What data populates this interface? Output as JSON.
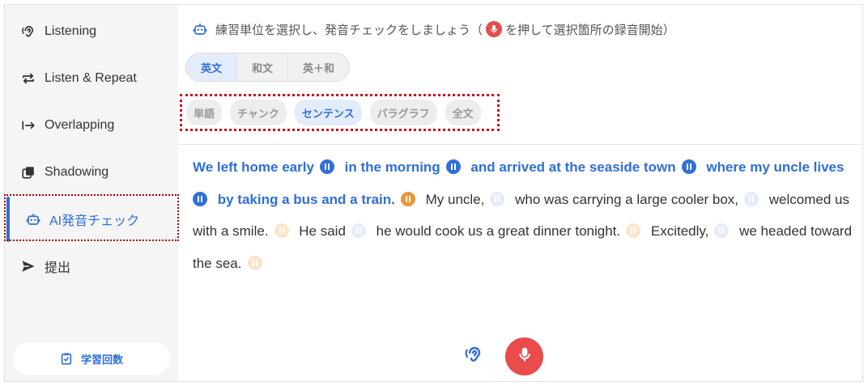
{
  "sidebar": {
    "items": [
      {
        "label": "Listening",
        "icon": "ear-icon"
      },
      {
        "label": "Listen & Repeat",
        "icon": "repeat-icon"
      },
      {
        "label": "Overlapping",
        "icon": "arrow-to-bar-icon"
      },
      {
        "label": "Shadowing",
        "icon": "shadow-squares-icon"
      },
      {
        "label": "AI発音チェック",
        "icon": "robot-icon",
        "active": true
      },
      {
        "label": "提出",
        "icon": "send-icon"
      }
    ],
    "study_count_label": "学習回数"
  },
  "main": {
    "instruction_before": "練習単位を選択し、発音チェックをしましょう（",
    "instruction_after": "を押して選択箇所の録音開始）",
    "lang_tabs": [
      {
        "label": "英文",
        "active": true
      },
      {
        "label": "和文",
        "active": false
      },
      {
        "label": "英＋和",
        "active": false
      }
    ],
    "unit_tabs": [
      {
        "label": "単語",
        "active": false
      },
      {
        "label": "チャンク",
        "active": false
      },
      {
        "label": "センテンス",
        "active": true
      },
      {
        "label": "パラグラフ",
        "active": false
      },
      {
        "label": "全文",
        "active": false
      }
    ],
    "passage": [
      {
        "text": "We left home early",
        "highlight": true,
        "button": "blue"
      },
      {
        "text": "in the morning",
        "highlight": true,
        "button": "blue"
      },
      {
        "text": "and arrived at the seaside town",
        "highlight": true,
        "button": "blue"
      },
      {
        "text": "where my uncle lives",
        "highlight": true,
        "button": "blue"
      },
      {
        "text": "by taking a bus and a train.",
        "highlight": true,
        "button": "orange"
      },
      {
        "text": "My uncle,",
        "highlight": false,
        "button": "pale-blue"
      },
      {
        "text": "who was carrying a large cooler box,",
        "highlight": false,
        "button": "pale-blue"
      },
      {
        "text": "welcomed us with a smile.",
        "highlight": false,
        "button": "pale-orange"
      },
      {
        "text": "He said",
        "highlight": false,
        "button": "pale-blue"
      },
      {
        "text": "he would cook us a great dinner tonight.",
        "highlight": false,
        "button": "pale-orange"
      },
      {
        "text": "Excitedly,",
        "highlight": false,
        "button": "pale-blue"
      },
      {
        "text": "we headed toward the sea.",
        "highlight": false,
        "button": "pale-orange"
      }
    ]
  },
  "colors": {
    "accent": "#2f6fd6",
    "record": "#ea4b4b",
    "chunk_end": "#e8963a",
    "highlight_box": "#d0021b"
  }
}
